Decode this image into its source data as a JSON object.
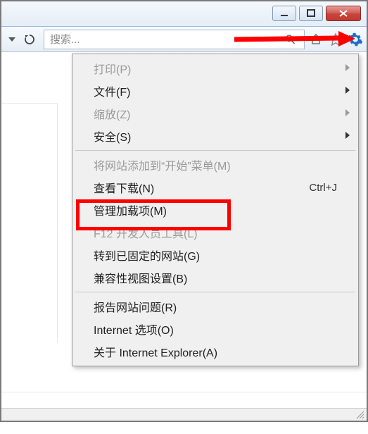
{
  "search": {
    "placeholder": "搜索..."
  },
  "menu": {
    "print": "打印(P)",
    "file": "文件(F)",
    "zoom": "缩放(Z)",
    "safety": "安全(S)",
    "add_to_start": "将网站添加到“开始”菜单(M)",
    "view_downloads": "查看下载(N)",
    "view_downloads_shortcut": "Ctrl+J",
    "manage_addons": "管理加载项(M)",
    "f12_tools": "F12 开发人员工具(L)",
    "goto_pinned": "转到已固定的网站(G)",
    "compat_view": "兼容性视图设置(B)",
    "report_problem": "报告网站问题(R)",
    "internet_options": "Internet 选项(O)",
    "about": "关于 Internet Explorer(A)"
  }
}
